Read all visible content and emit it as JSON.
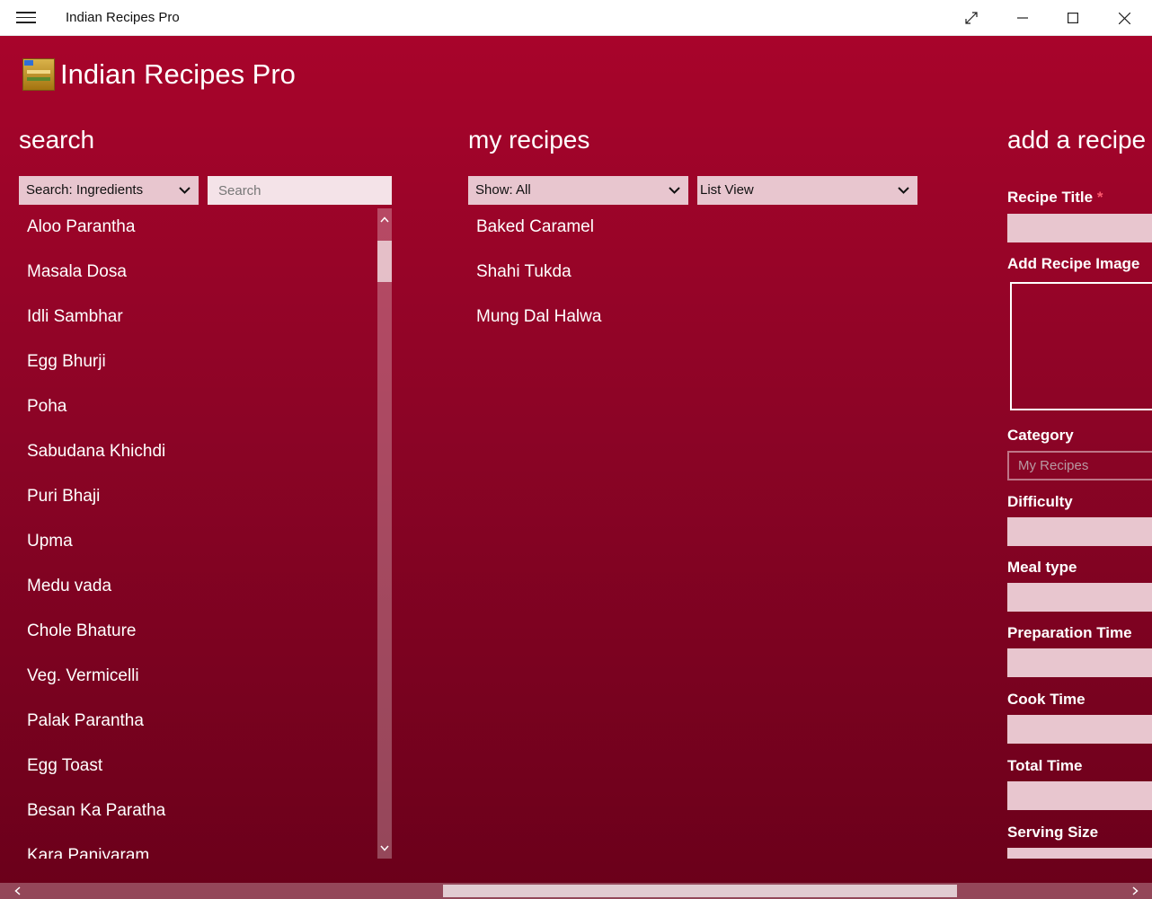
{
  "window": {
    "title": "Indian Recipes Pro",
    "icons": [
      "hamburger-menu-icon",
      "fullscreen-icon",
      "minimize-icon",
      "maximize-icon",
      "close-icon"
    ]
  },
  "header": {
    "title": "Indian Recipes Pro"
  },
  "search": {
    "heading": "search",
    "filter_selected": "Search: Ingredients",
    "placeholder": "Search",
    "recipes": [
      "Aloo Parantha",
      "Masala Dosa",
      "Idli Sambhar",
      "Egg Bhurji",
      "Poha",
      "Sabudana Khichdi",
      "Puri Bhaji",
      "Upma",
      "Medu vada",
      "Chole Bhature",
      "Veg. Vermicelli",
      "Palak Parantha",
      "Egg Toast",
      "Besan Ka Paratha",
      "Kara Paniyaram"
    ]
  },
  "my_recipes": {
    "heading": "my recipes",
    "show_selected": "Show: All",
    "view_selected": "List View",
    "recipes": [
      "Baked Caramel",
      "Shahi Tukda",
      "Mung Dal Halwa"
    ]
  },
  "add_recipe": {
    "heading": "add a recipe",
    "recipe_title_label": "Recipe Title",
    "required_mark": "*",
    "add_image_label": "Add Recipe Image",
    "category_label": "Category",
    "category_placeholder": "My Recipes",
    "difficulty_label": "Difficulty",
    "meal_type_label": "Meal type",
    "prep_time_label": "Preparation Time",
    "cook_time_label": "Cook Time",
    "total_time_label": "Total Time",
    "serving_size_label": "Serving Size"
  },
  "colors": {
    "background_top": "#a8042b",
    "background_bottom": "#6a001a",
    "input_fill": "#e8c6cf",
    "text": "#ffffff"
  }
}
